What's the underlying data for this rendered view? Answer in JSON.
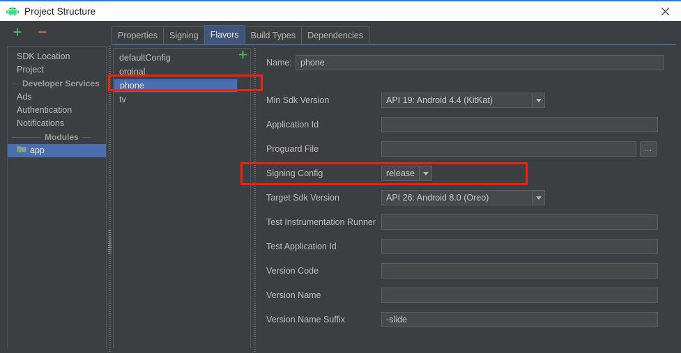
{
  "window": {
    "title": "Project Structure",
    "app_icon": "android-robot-icon",
    "close_icon": "close-icon"
  },
  "toolbar": {
    "add_label": "+",
    "add_icon": "plus-icon",
    "remove_label": "−",
    "remove_icon": "minus-icon"
  },
  "sidebar": {
    "items": [
      {
        "label": "SDK Location",
        "type": "item",
        "selected": false
      },
      {
        "label": "Project",
        "type": "item",
        "selected": false
      },
      {
        "label": "Developer Services",
        "type": "group",
        "selected": false
      },
      {
        "label": "Ads",
        "type": "item",
        "selected": false
      },
      {
        "label": "Authentication",
        "type": "item",
        "selected": false
      },
      {
        "label": "Notifications",
        "type": "item",
        "selected": false
      },
      {
        "label": "Modules",
        "type": "group",
        "selected": false
      },
      {
        "label": "app",
        "type": "module",
        "selected": true,
        "icon": "folder-icon"
      }
    ]
  },
  "tabs": [
    {
      "label": "Properties",
      "active": false
    },
    {
      "label": "Signing",
      "active": false
    },
    {
      "label": "Flavors",
      "active": true
    },
    {
      "label": "Build Types",
      "active": false
    },
    {
      "label": "Dependencies",
      "active": false
    }
  ],
  "flavors": {
    "add_label": "+",
    "add_icon": "plus-icon",
    "items": [
      {
        "label": "defaultConfig",
        "selected": false
      },
      {
        "label": "orginal",
        "selected": false
      },
      {
        "label": "phone",
        "selected": true
      },
      {
        "label": "tv",
        "selected": false
      }
    ]
  },
  "form": {
    "name_label": "Name:",
    "name_value": "phone",
    "fields": [
      {
        "label": "Min Sdk Version",
        "type": "combo",
        "value": "API 19: Android 4.4 (KitKat)"
      },
      {
        "label": "Application Id",
        "type": "text",
        "value": ""
      },
      {
        "label": "Proguard File",
        "type": "browse",
        "value": "",
        "browse_label": "..."
      },
      {
        "label": "Signing Config",
        "type": "combo-small",
        "value": "release"
      },
      {
        "label": "Target Sdk Version",
        "type": "combo",
        "value": "API 26: Android 8.0 (Oreo)"
      },
      {
        "label": "Test Instrumentation Runner",
        "type": "text",
        "value": ""
      },
      {
        "label": "Test Application Id",
        "type": "text",
        "value": ""
      },
      {
        "label": "Version Code",
        "type": "text",
        "value": ""
      },
      {
        "label": "Version Name",
        "type": "text",
        "value": ""
      },
      {
        "label": "Version Name Suffix",
        "type": "text",
        "value": "-slide"
      }
    ]
  },
  "annotations": {
    "highlight_color": "#f41f0c",
    "boxes": [
      {
        "name": "phone-flavor-highlight"
      },
      {
        "name": "signing-config-highlight"
      }
    ]
  }
}
